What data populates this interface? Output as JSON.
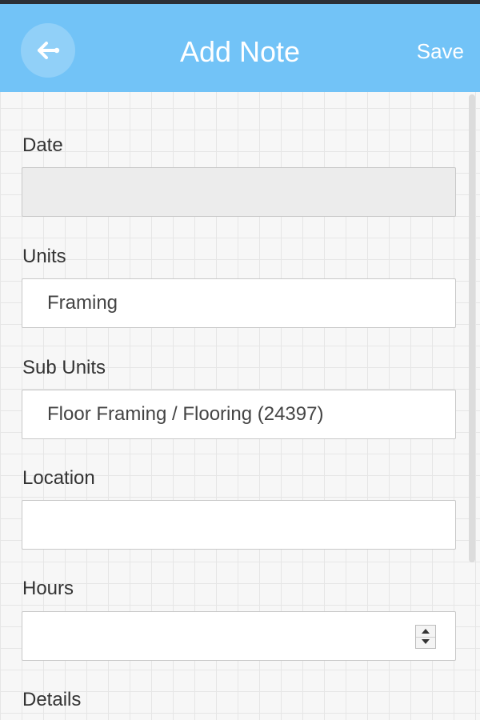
{
  "header": {
    "title": "Add Note",
    "save_label": "Save",
    "back_icon": "arrow-left-icon",
    "background_color": "#72c3f7"
  },
  "form": {
    "date": {
      "label": "Date",
      "value": ""
    },
    "units": {
      "label": "Units",
      "value": "Framing"
    },
    "sub_units": {
      "label": "Sub Units",
      "value": "Floor Framing / Flooring (24397)"
    },
    "location": {
      "label": "Location",
      "value": ""
    },
    "hours": {
      "label": "Hours",
      "value": ""
    },
    "details": {
      "label": "Details"
    }
  }
}
